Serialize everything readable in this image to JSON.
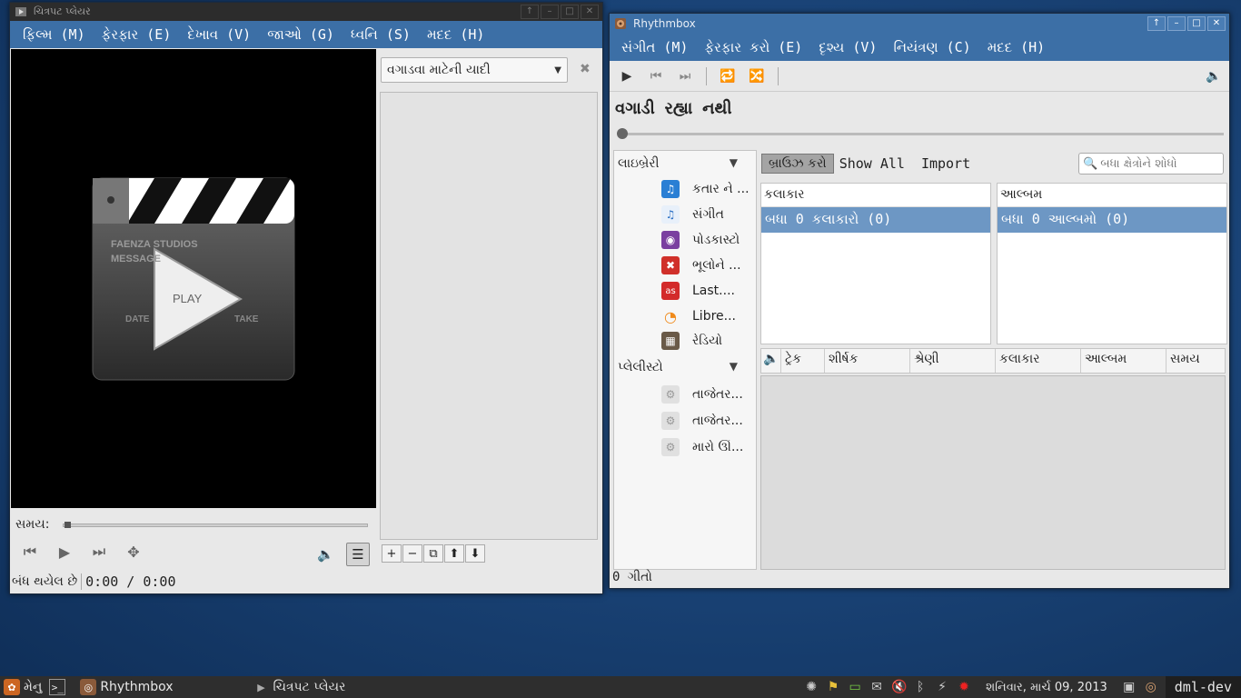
{
  "movie_player": {
    "title": "ચિત્રપટ પ્લેયર",
    "menu": [
      "ફિલ્મ (M)",
      "ફેરફાર (E)",
      "દેખાવ (V)",
      "જાઓ (G)",
      "ધ્વનિ (S)",
      "મદદ (H)"
    ],
    "video_logo": {
      "line1": "FAENZA STUDIOS",
      "line2": "MESSAGE",
      "play": "PLAY",
      "date": "DATE",
      "take": "TAKE"
    },
    "playlist_select": "વગાડવા માટેની યાદી",
    "time_label": "સમય:",
    "status": "બંધ થયેલ છે",
    "time": "0:00 / 0:00",
    "playlist_tools": [
      "+",
      "−",
      "⧉",
      "⬆",
      "⬇"
    ]
  },
  "rhythmbox": {
    "title": "Rhythmbox",
    "menu": [
      "સંગીત (M)",
      "ફેરફાર કરો (E)",
      "દૃશ્ય (V)",
      "નિયંત્રણ (C)",
      "મદદ (H)"
    ],
    "now_playing": "વગાડી રહ્યા નથી",
    "library_header": "લાઇબ્રેરી",
    "library_items": [
      {
        "label": "કતાર ને ...",
        "icon": "music-note-icon"
      },
      {
        "label": "સંગીત",
        "icon": "music-note-icon"
      },
      {
        "label": "પોડકાસ્ટો",
        "icon": "podcast-icon"
      },
      {
        "label": "ભૂલોને ...",
        "icon": "error-icon"
      },
      {
        "label": "Last....",
        "icon": "lastfm-icon"
      },
      {
        "label": "Libre...",
        "icon": "wifi-icon"
      },
      {
        "label": "રેડિયો",
        "icon": "radio-icon"
      }
    ],
    "playlists_header": "પ્લેલીસ્ટો",
    "playlist_items": [
      {
        "label": "તાજેતર...",
        "icon": "gear-icon"
      },
      {
        "label": "તાજેતર...",
        "icon": "gear-icon"
      },
      {
        "label": "મારો ઊંં...",
        "icon": "gear-icon"
      }
    ],
    "browse_button": "બ્રાઉઝ કરો",
    "show_all": "Show All",
    "import": "Import",
    "search_placeholder": "બધા ક્ષેત્રોને શોધો",
    "artist_header": "કલાકાર",
    "artist_selected": "બધા 0 કલાકારો (0)",
    "album_header": "આલ્બમ",
    "album_selected": "બધા 0 આલ્બમો (0)",
    "track_columns": [
      "ટ્રેક",
      "શીર્ષક",
      "શ્રેણી",
      "કલાકાર",
      "આલ્બમ",
      "સમય"
    ],
    "status": "0 ગીતો"
  },
  "taskbar": {
    "menu": "મેનુ",
    "tasks": [
      "Rhythmbox",
      "ચિત્રપટ પ્લેયર"
    ],
    "clock": "શનિવાર, માર્ચ 09, 2013",
    "host": "dml-dev"
  }
}
